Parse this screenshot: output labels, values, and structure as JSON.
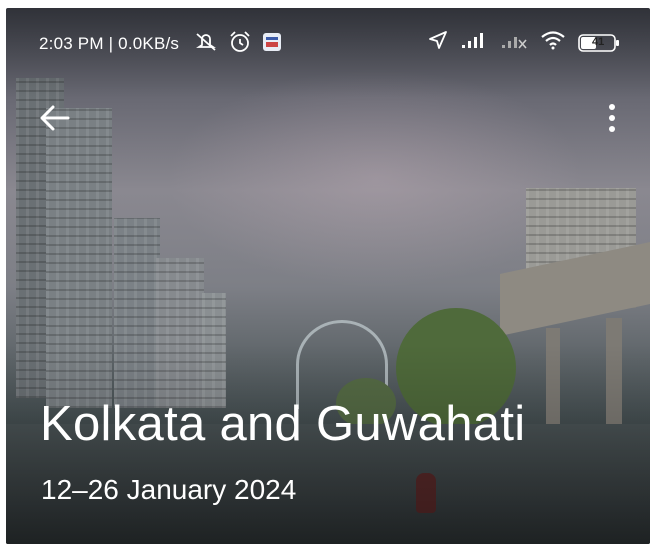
{
  "status_bar": {
    "time_speed": "2:03 PM | 0.0KB/s",
    "battery": "41",
    "icons": [
      "mute-icon",
      "alarm-icon",
      "app-notification-icon",
      "location-icon",
      "signal-icon",
      "signal-no-service-icon",
      "wifi-icon",
      "battery-icon"
    ]
  },
  "toolbar": {
    "back_icon": "arrow-left-icon",
    "more_icon": "more-vertical-icon"
  },
  "trip": {
    "title": "Kolkata and Guwahati",
    "dates": "12–26 January 2024"
  }
}
